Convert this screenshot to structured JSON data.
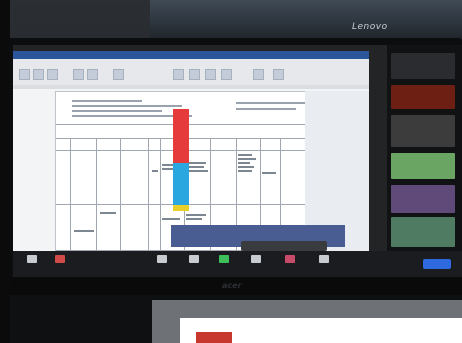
{
  "scene": {
    "top_monitor_brand": "Lenovo",
    "monitor_brand": "acer"
  },
  "shared_document": {
    "app": "Word",
    "title_text": "",
    "ribbon_tabs": [
      "",
      "",
      "",
      "",
      "",
      "",
      "",
      ""
    ],
    "highlight_colors": [
      "#e53b3b",
      "#2aa7de",
      "#e8cf2a"
    ]
  },
  "share_banner": {
    "label": ""
  },
  "gallery": {
    "tiles": [
      {
        "label": "",
        "color": "#2a2c30"
      },
      {
        "label": "",
        "color": "#6e1f14"
      },
      {
        "label": "",
        "color": "#3c3c3c"
      },
      {
        "label": "",
        "color": "#6aa564"
      },
      {
        "label": "",
        "color": "#5f4a7a"
      },
      {
        "label": "",
        "color": "#4f7b62"
      }
    ]
  },
  "toolbar": {
    "items": [
      {
        "label": "",
        "icon": "mic-icon"
      },
      {
        "label": "",
        "icon": "video-icon"
      },
      {
        "label": "",
        "icon": "participants-icon"
      },
      {
        "label": "",
        "icon": "chat-icon"
      },
      {
        "label": "",
        "icon": "share-screen-icon"
      },
      {
        "label": "",
        "icon": "record-icon"
      },
      {
        "label": "",
        "icon": "reactions-icon"
      },
      {
        "label": "",
        "icon": "apps-icon"
      }
    ],
    "leave_label": "",
    "share_color": "#3fbf5a",
    "leave_color": "#2d6ae0"
  }
}
